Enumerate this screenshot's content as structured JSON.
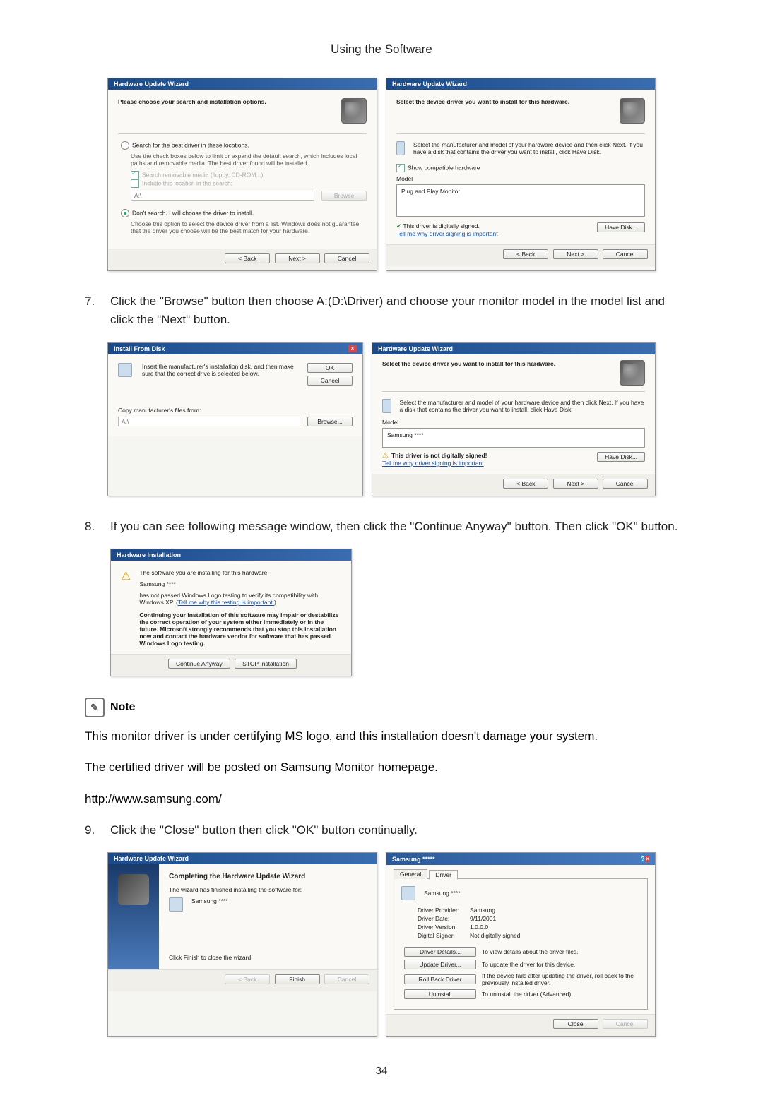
{
  "page_header": "Using the Software",
  "page_number": "34",
  "step7": {
    "num": "7.",
    "text": "Click the \"Browse\" button then choose A:(D:\\Driver) and choose your monitor model in the model list and click the \"Next\" button."
  },
  "step8": {
    "num": "8.",
    "text": "If you can see following message window, then click the \"Continue Anyway\" button. Then click \"OK\" button."
  },
  "step9": {
    "num": "9.",
    "text": "Click the \"Close\" button then click \"OK\" button continually."
  },
  "note": {
    "label": "Note",
    "p1": "This monitor driver is under certifying MS logo, and this installation doesn't damage your system.",
    "p2": "The certified driver will be posted on Samsung Monitor homepage.",
    "url": "http://www.samsung.com/"
  },
  "dlg1": {
    "title": "Hardware Update Wizard",
    "head": "Please choose your search and installation options.",
    "opt1": "Search for the best driver in these locations.",
    "opt1_desc": "Use the check boxes below to limit or expand the default search, which includes local paths and removable media. The best driver found will be installed.",
    "chk1": "Search removable media (floppy, CD-ROM...)",
    "chk2": "Include this location in the search:",
    "path": "A:\\",
    "browse": "Browse",
    "opt2": "Don't search. I will choose the driver to install.",
    "opt2_desc": "Choose this option to select the device driver from a list. Windows does not guarantee that the driver you choose will be the best match for your hardware.",
    "back": "< Back",
    "next": "Next >",
    "cancel": "Cancel"
  },
  "dlg2": {
    "title": "Hardware Update Wizard",
    "head": "Select the device driver you want to install for this hardware.",
    "desc": "Select the manufacturer and model of your hardware device and then click Next. If you have a disk that contains the driver you want to install, click Have Disk.",
    "show_compat": "Show compatible hardware",
    "model_label": "Model",
    "model_item": "Plug and Play Monitor",
    "signed": "This driver is digitally signed.",
    "tell": "Tell me why driver signing is important",
    "have_disk": "Have Disk...",
    "back": "< Back",
    "next": "Next >",
    "cancel": "Cancel"
  },
  "dlg3": {
    "title": "Install From Disk",
    "msg": "Insert the manufacturer's installation disk, and then make sure that the correct drive is selected below.",
    "ok": "OK",
    "cancel": "Cancel",
    "copy_label": "Copy manufacturer's files from:",
    "path": "A:\\",
    "browse": "Browse..."
  },
  "dlg4": {
    "title": "Hardware Update Wizard",
    "head": "Select the device driver you want to install for this hardware.",
    "desc": "Select the manufacturer and model of your hardware device and then click Next. If you have a disk that contains the driver you want to install, click Have Disk.",
    "model_label": "Model",
    "model_item": "Samsung ****",
    "not_signed": "This driver is not digitally signed!",
    "tell": "Tell me why driver signing is important",
    "have_disk": "Have Disk...",
    "back": "< Back",
    "next": "Next >",
    "cancel": "Cancel"
  },
  "dlg5": {
    "title": "Hardware Installation",
    "l1": "The software you are installing for this hardware:",
    "l2": "Samsung ****",
    "l3": "has not passed Windows Logo testing to verify its compatibility with Windows XP. (",
    "l3_link": "Tell me why this testing is important.",
    "l3_end": ")",
    "warn": "Continuing your installation of this software may impair or destabilize the correct operation of your system either immediately or in the future. Microsoft strongly recommends that you stop this installation now and contact the hardware vendor for software that has passed Windows Logo testing.",
    "cont": "Continue Anyway",
    "stop": "STOP Installation"
  },
  "dlg6": {
    "title": "Hardware Update Wizard",
    "head": "Completing the Hardware Update Wizard",
    "sub": "The wizard has finished installing the software for:",
    "item": "Samsung ****",
    "close_hint": "Click Finish to close the wizard.",
    "back": "< Back",
    "finish": "Finish",
    "cancel": "Cancel"
  },
  "dlg7": {
    "title": "Samsung *****",
    "tab_general": "General",
    "tab_driver": "Driver",
    "dev": "Samsung ****",
    "rows": {
      "provider_l": "Driver Provider:",
      "provider_v": "Samsung",
      "date_l": "Driver Date:",
      "date_v": "9/11/2001",
      "version_l": "Driver Version:",
      "version_v": "1.0.0.0",
      "signer_l": "Digital Signer:",
      "signer_v": "Not digitally signed"
    },
    "btns": {
      "details": "Driver Details...",
      "details_d": "To view details about the driver files.",
      "update": "Update Driver...",
      "update_d": "To update the driver for this device.",
      "roll": "Roll Back Driver",
      "roll_d": "If the device fails after updating the driver, roll back to the previously installed driver.",
      "uninstall": "Uninstall",
      "uninstall_d": "To uninstall the driver (Advanced)."
    },
    "close": "Close",
    "cancel": "Cancel"
  }
}
